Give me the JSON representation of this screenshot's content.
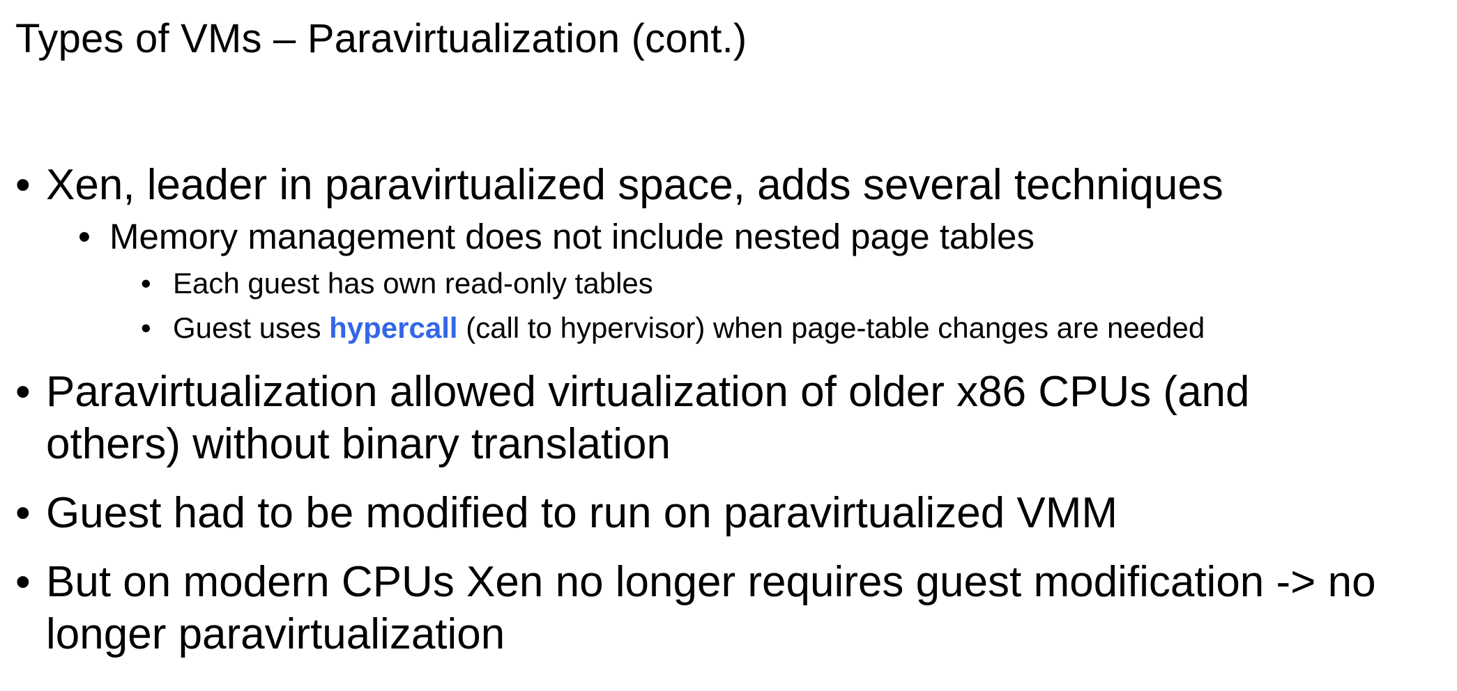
{
  "slide": {
    "title": "Types of VMs – Paravirtualization (cont.)",
    "bullet_glyph": "•",
    "highlight_color": "#3366e8",
    "bullets": [
      {
        "text": "Xen, leader in paravirtualized space, adds several techniques",
        "sub": [
          {
            "text": "Memory management does not include nested page tables",
            "sub": [
              {
                "text": "Each guest has own read-only tables"
              },
              {
                "prefix": "Guest uses ",
                "highlight": "hypercall",
                "suffix": " (call to hypervisor) when page-table changes are needed"
              }
            ]
          }
        ]
      },
      {
        "line1": "Paravirtualization allowed virtualization of older x86 CPUs (and",
        "line2": "others) without binary translation"
      },
      {
        "text": "Guest had to be modified to run on paravirtualized VMM"
      },
      {
        "line1": "But on modern CPUs Xen no longer requires guest modification -> no",
        "line2": "longer paravirtualization"
      }
    ]
  }
}
